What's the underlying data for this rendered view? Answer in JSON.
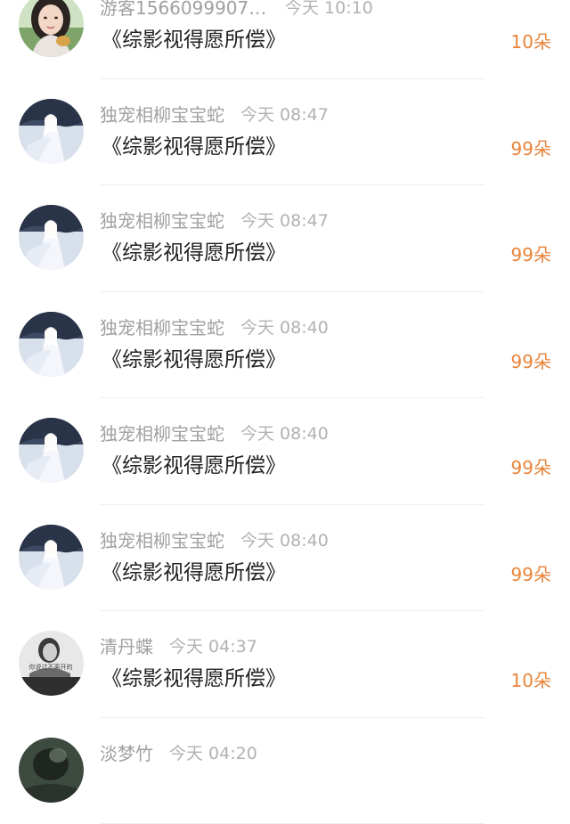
{
  "records": [
    {
      "name": "游客15660999070...",
      "time": "今天 10:10",
      "gift": "《综影视得愿所偿》",
      "amount": "10朵",
      "avatar": "woman-photo-icon"
    },
    {
      "name": "独宠相柳宝宝蛇",
      "time": "今天 08:47",
      "gift": "《综影视得愿所偿》",
      "amount": "99朵",
      "avatar": "white-robed-figure-icon"
    },
    {
      "name": "独宠相柳宝宝蛇",
      "time": "今天 08:47",
      "gift": "《综影视得愿所偿》",
      "amount": "99朵",
      "avatar": "white-robed-figure-icon"
    },
    {
      "name": "独宠相柳宝宝蛇",
      "time": "今天 08:40",
      "gift": "《综影视得愿所偿》",
      "amount": "99朵",
      "avatar": "white-robed-figure-icon"
    },
    {
      "name": "独宠相柳宝宝蛇",
      "time": "今天 08:40",
      "gift": "《综影视得愿所偿》",
      "amount": "99朵",
      "avatar": "white-robed-figure-icon"
    },
    {
      "name": "独宠相柳宝宝蛇",
      "time": "今天 08:40",
      "gift": "《综影视得愿所偿》",
      "amount": "99朵",
      "avatar": "white-robed-figure-icon"
    },
    {
      "name": "清丹蝶",
      "time": "今天 04:37",
      "gift": "《综影视得愿所偿》",
      "amount": "10朵",
      "avatar": "monochrome-woman-photo-icon",
      "avatar_text": "你说过不离开的"
    },
    {
      "name": "淡梦竹",
      "time": "今天 04:20",
      "gift": "",
      "amount": "",
      "avatar": "dark-photo-icon"
    }
  ],
  "colors": {
    "name": "#a0a0a0",
    "time": "#b2b2b2",
    "gift": "#222222",
    "amount": "#e9843a",
    "divider": "#efefef"
  }
}
